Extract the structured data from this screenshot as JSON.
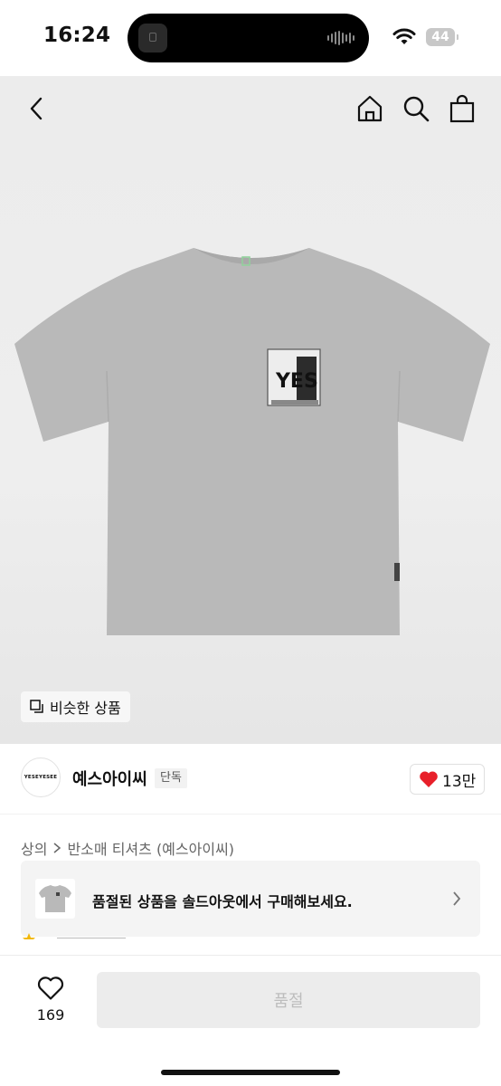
{
  "status_bar": {
    "time": "16:24",
    "battery": "44",
    "icons": [
      "wifi-icon",
      "battery-icon"
    ]
  },
  "nav": {
    "icons": [
      "back-icon",
      "home-icon",
      "search-icon",
      "shopping-bag-icon"
    ]
  },
  "product_image": {
    "print_text": "YES",
    "similar_button_label": "비슷한 상품",
    "similar_icon": "copy-icon"
  },
  "brand": {
    "logo_text": "YESEYESEE",
    "name": "예스아이씨",
    "badge": "단독",
    "likes": "13만",
    "like_icon": "heart-filled-icon"
  },
  "breadcrumb": {
    "category": "상의",
    "subcategory": "반소매 티셔츠 (예스아이씨)"
  },
  "soldout_banner": {
    "text": "품절된 상품을 솔드아웃에서 구매해보세요."
  },
  "bottom_bar": {
    "wish_count": "169",
    "buy_label": "품절"
  },
  "colors": {
    "heart": "#e8202a",
    "shirt": "#b9b9b9",
    "disabled_button": "#ececec"
  }
}
